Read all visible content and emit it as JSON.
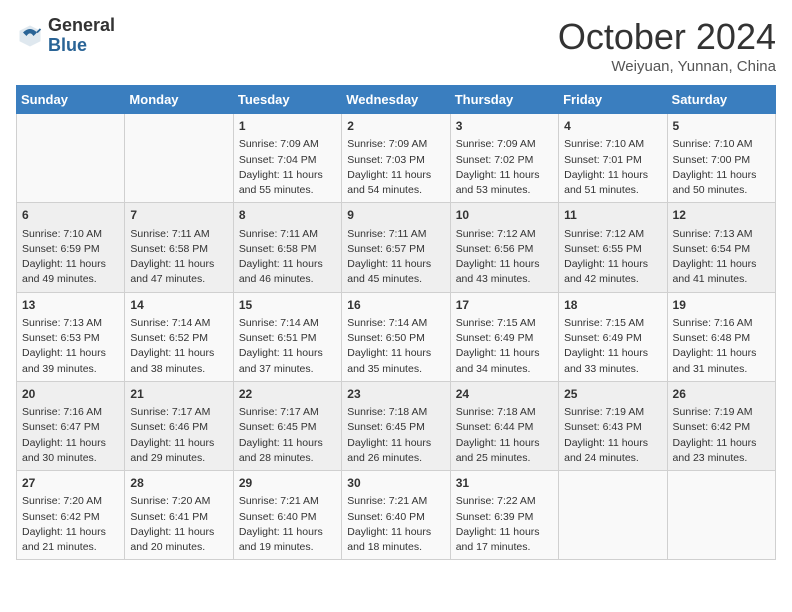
{
  "header": {
    "logo_general": "General",
    "logo_blue": "Blue",
    "month_title": "October 2024",
    "location": "Weiyuan, Yunnan, China"
  },
  "days_of_week": [
    "Sunday",
    "Monday",
    "Tuesday",
    "Wednesday",
    "Thursday",
    "Friday",
    "Saturday"
  ],
  "weeks": [
    [
      {
        "day": "",
        "sunrise": "",
        "sunset": "",
        "daylight": ""
      },
      {
        "day": "",
        "sunrise": "",
        "sunset": "",
        "daylight": ""
      },
      {
        "day": "1",
        "sunrise": "Sunrise: 7:09 AM",
        "sunset": "Sunset: 7:04 PM",
        "daylight": "Daylight: 11 hours and 55 minutes."
      },
      {
        "day": "2",
        "sunrise": "Sunrise: 7:09 AM",
        "sunset": "Sunset: 7:03 PM",
        "daylight": "Daylight: 11 hours and 54 minutes."
      },
      {
        "day": "3",
        "sunrise": "Sunrise: 7:09 AM",
        "sunset": "Sunset: 7:02 PM",
        "daylight": "Daylight: 11 hours and 53 minutes."
      },
      {
        "day": "4",
        "sunrise": "Sunrise: 7:10 AM",
        "sunset": "Sunset: 7:01 PM",
        "daylight": "Daylight: 11 hours and 51 minutes."
      },
      {
        "day": "5",
        "sunrise": "Sunrise: 7:10 AM",
        "sunset": "Sunset: 7:00 PM",
        "daylight": "Daylight: 11 hours and 50 minutes."
      }
    ],
    [
      {
        "day": "6",
        "sunrise": "Sunrise: 7:10 AM",
        "sunset": "Sunset: 6:59 PM",
        "daylight": "Daylight: 11 hours and 49 minutes."
      },
      {
        "day": "7",
        "sunrise": "Sunrise: 7:11 AM",
        "sunset": "Sunset: 6:58 PM",
        "daylight": "Daylight: 11 hours and 47 minutes."
      },
      {
        "day": "8",
        "sunrise": "Sunrise: 7:11 AM",
        "sunset": "Sunset: 6:58 PM",
        "daylight": "Daylight: 11 hours and 46 minutes."
      },
      {
        "day": "9",
        "sunrise": "Sunrise: 7:11 AM",
        "sunset": "Sunset: 6:57 PM",
        "daylight": "Daylight: 11 hours and 45 minutes."
      },
      {
        "day": "10",
        "sunrise": "Sunrise: 7:12 AM",
        "sunset": "Sunset: 6:56 PM",
        "daylight": "Daylight: 11 hours and 43 minutes."
      },
      {
        "day": "11",
        "sunrise": "Sunrise: 7:12 AM",
        "sunset": "Sunset: 6:55 PM",
        "daylight": "Daylight: 11 hours and 42 minutes."
      },
      {
        "day": "12",
        "sunrise": "Sunrise: 7:13 AM",
        "sunset": "Sunset: 6:54 PM",
        "daylight": "Daylight: 11 hours and 41 minutes."
      }
    ],
    [
      {
        "day": "13",
        "sunrise": "Sunrise: 7:13 AM",
        "sunset": "Sunset: 6:53 PM",
        "daylight": "Daylight: 11 hours and 39 minutes."
      },
      {
        "day": "14",
        "sunrise": "Sunrise: 7:14 AM",
        "sunset": "Sunset: 6:52 PM",
        "daylight": "Daylight: 11 hours and 38 minutes."
      },
      {
        "day": "15",
        "sunrise": "Sunrise: 7:14 AM",
        "sunset": "Sunset: 6:51 PM",
        "daylight": "Daylight: 11 hours and 37 minutes."
      },
      {
        "day": "16",
        "sunrise": "Sunrise: 7:14 AM",
        "sunset": "Sunset: 6:50 PM",
        "daylight": "Daylight: 11 hours and 35 minutes."
      },
      {
        "day": "17",
        "sunrise": "Sunrise: 7:15 AM",
        "sunset": "Sunset: 6:49 PM",
        "daylight": "Daylight: 11 hours and 34 minutes."
      },
      {
        "day": "18",
        "sunrise": "Sunrise: 7:15 AM",
        "sunset": "Sunset: 6:49 PM",
        "daylight": "Daylight: 11 hours and 33 minutes."
      },
      {
        "day": "19",
        "sunrise": "Sunrise: 7:16 AM",
        "sunset": "Sunset: 6:48 PM",
        "daylight": "Daylight: 11 hours and 31 minutes."
      }
    ],
    [
      {
        "day": "20",
        "sunrise": "Sunrise: 7:16 AM",
        "sunset": "Sunset: 6:47 PM",
        "daylight": "Daylight: 11 hours and 30 minutes."
      },
      {
        "day": "21",
        "sunrise": "Sunrise: 7:17 AM",
        "sunset": "Sunset: 6:46 PM",
        "daylight": "Daylight: 11 hours and 29 minutes."
      },
      {
        "day": "22",
        "sunrise": "Sunrise: 7:17 AM",
        "sunset": "Sunset: 6:45 PM",
        "daylight": "Daylight: 11 hours and 28 minutes."
      },
      {
        "day": "23",
        "sunrise": "Sunrise: 7:18 AM",
        "sunset": "Sunset: 6:45 PM",
        "daylight": "Daylight: 11 hours and 26 minutes."
      },
      {
        "day": "24",
        "sunrise": "Sunrise: 7:18 AM",
        "sunset": "Sunset: 6:44 PM",
        "daylight": "Daylight: 11 hours and 25 minutes."
      },
      {
        "day": "25",
        "sunrise": "Sunrise: 7:19 AM",
        "sunset": "Sunset: 6:43 PM",
        "daylight": "Daylight: 11 hours and 24 minutes."
      },
      {
        "day": "26",
        "sunrise": "Sunrise: 7:19 AM",
        "sunset": "Sunset: 6:42 PM",
        "daylight": "Daylight: 11 hours and 23 minutes."
      }
    ],
    [
      {
        "day": "27",
        "sunrise": "Sunrise: 7:20 AM",
        "sunset": "Sunset: 6:42 PM",
        "daylight": "Daylight: 11 hours and 21 minutes."
      },
      {
        "day": "28",
        "sunrise": "Sunrise: 7:20 AM",
        "sunset": "Sunset: 6:41 PM",
        "daylight": "Daylight: 11 hours and 20 minutes."
      },
      {
        "day": "29",
        "sunrise": "Sunrise: 7:21 AM",
        "sunset": "Sunset: 6:40 PM",
        "daylight": "Daylight: 11 hours and 19 minutes."
      },
      {
        "day": "30",
        "sunrise": "Sunrise: 7:21 AM",
        "sunset": "Sunset: 6:40 PM",
        "daylight": "Daylight: 11 hours and 18 minutes."
      },
      {
        "day": "31",
        "sunrise": "Sunrise: 7:22 AM",
        "sunset": "Sunset: 6:39 PM",
        "daylight": "Daylight: 11 hours and 17 minutes."
      },
      {
        "day": "",
        "sunrise": "",
        "sunset": "",
        "daylight": ""
      },
      {
        "day": "",
        "sunrise": "",
        "sunset": "",
        "daylight": ""
      }
    ]
  ]
}
